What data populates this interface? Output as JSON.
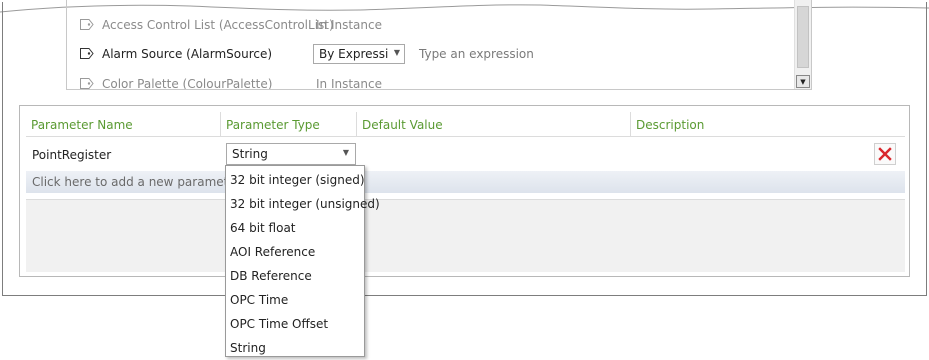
{
  "properties": [
    {
      "name": "Access Control List (AccessControlList)",
      "value": "In Instance",
      "dimmed": true
    },
    {
      "name": "Alarm Source (AlarmSource)",
      "combo_value": "By Expressic",
      "expression_placeholder": "Type an expression",
      "dimmed": false
    },
    {
      "name": "Color Palette (ColourPalette)",
      "value": "In Instance",
      "dimmed": true
    }
  ],
  "grid": {
    "headers": [
      "Parameter Name",
      "Parameter Type",
      "Default Value",
      "Description"
    ],
    "rows": [
      {
        "name": "PointRegister",
        "type": "String"
      }
    ],
    "add_placeholder": "Click here to add a new parameter"
  },
  "type_options": [
    "32 bit integer (signed)",
    "32 bit integer (unsigned)",
    "64 bit float",
    "AOI Reference",
    "DB Reference",
    "OPC Time",
    "OPC Time Offset",
    "String"
  ],
  "icons": {
    "property": "property-tag-icon",
    "dropdown": "chevron-down-icon",
    "delete": "delete-x-icon",
    "scroll_down": "scroll-down-arrow-icon"
  },
  "colors": {
    "header_text": "#5a9a32",
    "delete_x": "#d9262c"
  }
}
